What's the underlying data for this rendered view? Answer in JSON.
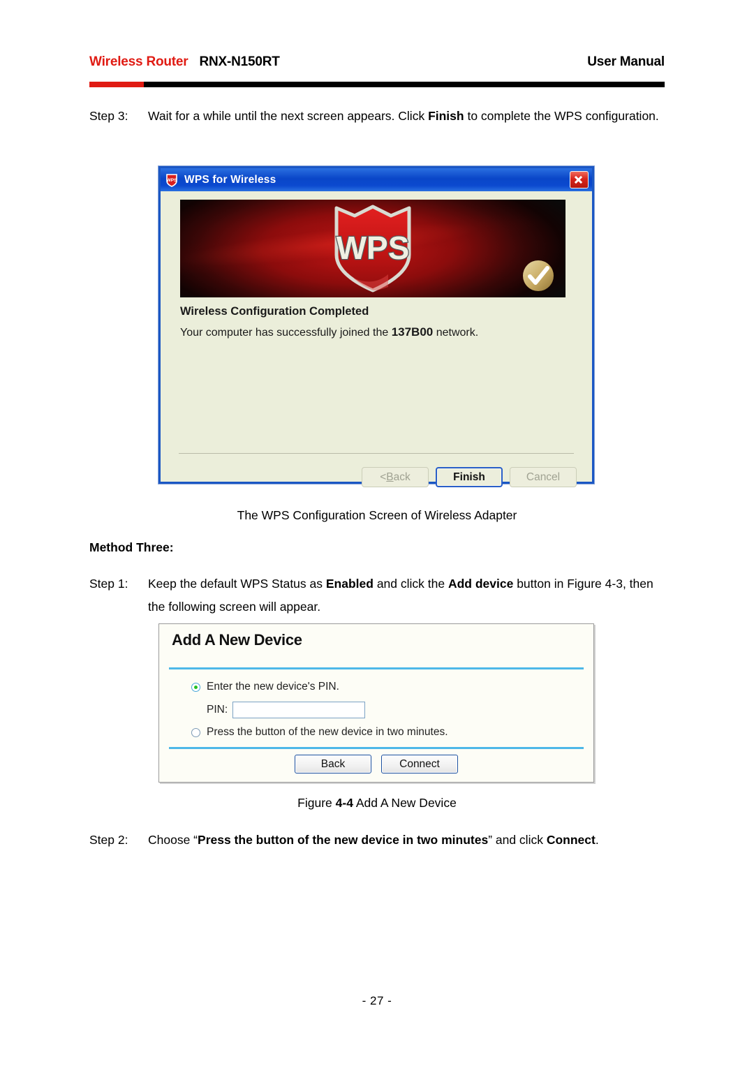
{
  "header": {
    "brand": "Wireless Router",
    "model": "RNX-N150RT",
    "right": "User Manual"
  },
  "step3": {
    "label": "Step 3:",
    "text_part1": "Wait for a while until the next screen appears. Click ",
    "bold1": "Finish",
    "text_part2": " to complete the WPS configuration."
  },
  "wps_dialog": {
    "title": "WPS for Wireless",
    "icon": "wps-shield-icon",
    "close_icon": "close-icon",
    "banner_logo_text": "WPS",
    "banner_check_icon": "check-circle-icon",
    "heading": "Wireless Configuration Completed",
    "message_prefix": "Your computer has successfully joined the ",
    "ssid": "137B00",
    "message_suffix": " network.",
    "buttons": {
      "back": "< Back",
      "back_prefix": "< ",
      "back_mnemonic": "B",
      "back_rest": "ack",
      "finish": "Finish",
      "cancel": "Cancel"
    }
  },
  "figure_caption_1": "The WPS Configuration Screen of Wireless Adapter",
  "method_three": "Method Three:",
  "step1": {
    "label": "Step 1:",
    "text_part1": "Keep the default WPS Status as ",
    "bold1": "Enabled",
    "text_part2": " and click the ",
    "bold2": "Add device",
    "text_part3": " button in Figure 4-3, then the following screen will appear."
  },
  "add_device_panel": {
    "title": "Add A New Device",
    "option_pin_label": "Enter the new device's PIN.",
    "pin_field_label": "PIN:",
    "pin_value": "",
    "pin_placeholder": "",
    "option_button_label": "Press the button of the new device in two minutes.",
    "selected_option": "pin",
    "buttons": {
      "back": "Back",
      "connect": "Connect"
    }
  },
  "figure_caption_2": {
    "prefix": "Figure ",
    "number": "4-4",
    "suffix": "  Add A New Device"
  },
  "step2": {
    "label": "Step 2:",
    "text_part1": "Choose “",
    "bold1": "Press the button of the new device in two minutes",
    "text_part2": "” and click ",
    "bold2": "Connect",
    "text_part3": "."
  },
  "page_number": "- 27 -",
  "colors": {
    "brand_red": "#e01b13",
    "title_bar_blue": "#0a46c8",
    "dialog_bg": "#ebeeda",
    "tp_divider": "#4db8e8",
    "radio_green": "#22c022"
  }
}
